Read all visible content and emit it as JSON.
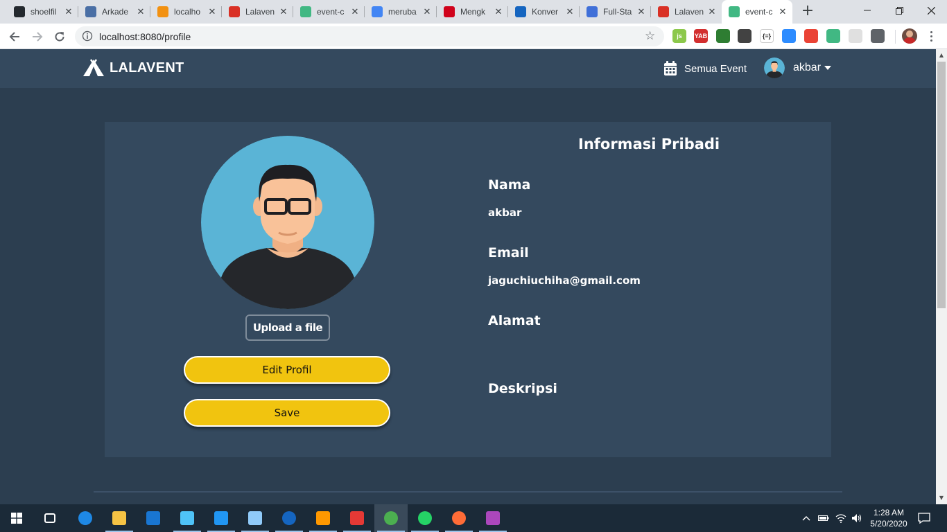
{
  "browser": {
    "tabs": [
      {
        "title": "shoelfil",
        "icon": "github-icon",
        "color": "#24292e"
      },
      {
        "title": "Arkade",
        "icon": "arkademy-icon",
        "color": "#4a6fa5"
      },
      {
        "title": "localho",
        "icon": "phpmyadmin-icon",
        "color": "#f29111"
      },
      {
        "title": "Lalaven",
        "icon": "gmail-icon",
        "color": "#d93025"
      },
      {
        "title": "event-c",
        "icon": "vue-icon",
        "color": "#41b883"
      },
      {
        "title": "meruba",
        "icon": "google-icon",
        "color": "#4285f4"
      },
      {
        "title": "Mengk",
        "icon": "red-circle-icon",
        "color": "#d0021b"
      },
      {
        "title": "Konver",
        "icon": "konver-icon",
        "color": "#1565c0"
      },
      {
        "title": "Full-Sta",
        "icon": "fullstack-icon",
        "color": "#3f6fd8"
      },
      {
        "title": "Lalaven",
        "icon": "gmail-icon",
        "color": "#d93025"
      },
      {
        "title": "event-c",
        "icon": "vue-icon",
        "color": "#41b883"
      }
    ],
    "active_tab_index": 10,
    "url": "localhost:8080/profile",
    "extensions": [
      {
        "icon": "nodejs-extension-icon",
        "color": "#8cc84b",
        "text": "js"
      },
      {
        "icon": "yab-extension-icon",
        "color": "#d32f2f",
        "text": "YAB"
      },
      {
        "icon": "globe-extension-icon",
        "color": "#2e7d32",
        "text": ""
      },
      {
        "icon": "incognito-extension-icon",
        "color": "#424242",
        "text": ""
      },
      {
        "icon": "json-extension-icon",
        "color": "#ffffff",
        "text": "{=}"
      },
      {
        "icon": "zoom-extension-icon",
        "color": "#2d8cff",
        "text": ""
      },
      {
        "icon": "calendar-extension-icon",
        "color": "#ea4335",
        "text": ""
      },
      {
        "icon": "vue-devtools-icon",
        "color": "#41b883",
        "text": ""
      },
      {
        "icon": "blank-extension-icon",
        "color": "#e0e0e0",
        "text": ""
      },
      {
        "icon": "camera-extension-icon",
        "color": "#5f6368",
        "text": ""
      }
    ]
  },
  "app": {
    "brand": "LALAVENT",
    "nav": {
      "events_label": "Semua Event",
      "user_name": "akbar"
    }
  },
  "profile": {
    "upload_label": "Upload a file",
    "edit_label": "Edit Profil",
    "save_label": "Save",
    "section_title": "Informasi Pribadi",
    "fields": [
      {
        "label": "Nama",
        "value": "akbar"
      },
      {
        "label": "Email",
        "value": "jaguchiuchiha@gmail.com"
      },
      {
        "label": "Alamat",
        "value": ""
      },
      {
        "label": "Deskripsi",
        "value": ""
      }
    ]
  },
  "taskbar": {
    "apps": [
      {
        "icon": "task-view-icon"
      },
      {
        "icon": "edge-icon"
      },
      {
        "icon": "file-explorer-icon"
      },
      {
        "icon": "mail-icon"
      },
      {
        "icon": "network-app-icon"
      },
      {
        "icon": "vscode-icon"
      },
      {
        "icon": "remote-desktop-icon"
      },
      {
        "icon": "round-blue-app-icon"
      },
      {
        "icon": "sublime-text-icon"
      },
      {
        "icon": "gameloft-icon"
      },
      {
        "icon": "chrome-icon"
      },
      {
        "icon": "whatsapp-icon"
      },
      {
        "icon": "postman-icon"
      },
      {
        "icon": "paint-icon"
      }
    ],
    "time": "1:28 AM",
    "date": "5/20/2020"
  },
  "colors": {
    "page_bg": "#2c3e50",
    "card_bg": "#34495e",
    "accent_yellow": "#f1c40f",
    "avatar_bg": "#5ab4d6"
  }
}
